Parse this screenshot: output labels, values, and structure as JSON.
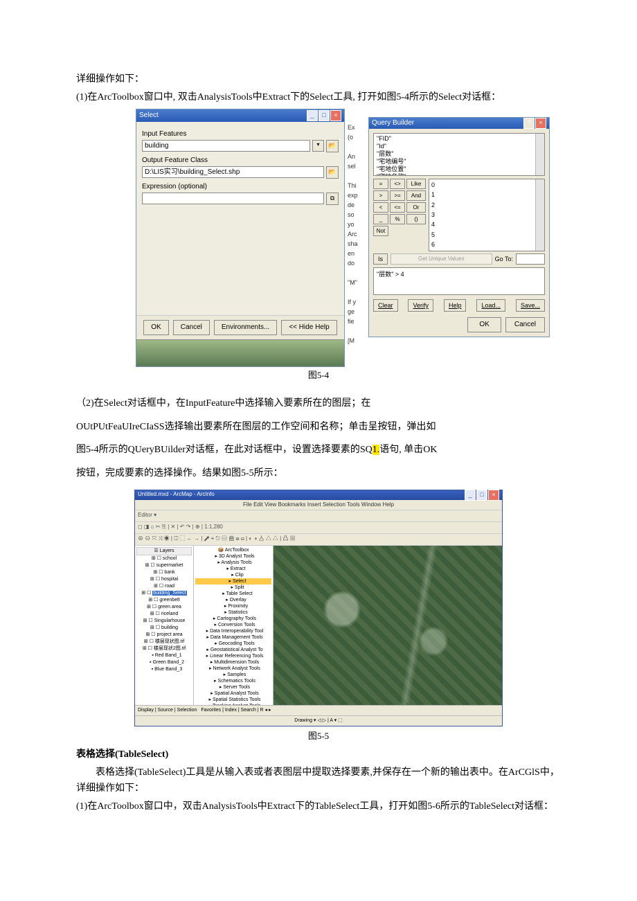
{
  "intro_line": "详细操作如下：",
  "step1": "(1)在ArcToolbox窗口中, 双击AnalysisTools中Extract下的Select工具, 打开如图5-4所示的Select对话框：",
  "fig54_caption": "图5-4",
  "select_dialog": {
    "title": "Select",
    "labels": {
      "input": "Input Features",
      "output": "Output Feature Class",
      "expr": "Expression (optional)"
    },
    "values": {
      "input": "building",
      "output": "D:\\LIS实习\\building_Select.shp",
      "expr": ""
    },
    "buttons": {
      "ok": "OK",
      "cancel": "Cancel",
      "env": "Environments...",
      "hide": "<< Hide Help"
    }
  },
  "midcol_lines": [
    "Ex",
    "(o",
    "",
    "An",
    "sel",
    "",
    "Thi",
    "exp",
    "de",
    "so",
    "yo",
    "Arc",
    "sha",
    "en",
    "do",
    "",
    "\"M\"",
    "",
    "If y",
    "ge",
    "fie",
    "",
    "[M"
  ],
  "qb": {
    "title": "Query Builder",
    "fields": [
      "\"FID\"",
      "\"Id\"",
      "\"层数\"",
      "\"宅地编号\"",
      "\"宅地位置\"",
      "\"宅地名称\""
    ],
    "ops_rows": [
      [
        "=",
        "<>",
        "Like"
      ],
      [
        ">",
        ">=",
        "And"
      ],
      [
        "<",
        "<=",
        "Or"
      ],
      [
        "_",
        "%",
        "()",
        "Not"
      ]
    ],
    "values_list": [
      "0",
      "1",
      "2",
      "3",
      "4",
      "5",
      "6"
    ],
    "is_label": "Is",
    "getunique": "Get Unique Values",
    "goto": "Go To:",
    "expression": "\"层数\" > 4",
    "buttons": {
      "clear": "Clear",
      "verify": "Verify",
      "help": "Help",
      "load": "Load...",
      "save": "Save...",
      "ok": "OK",
      "cancel": "Cancel"
    }
  },
  "para2_a": "（2)在Select对话框中，在InputFeature中选择输入要素所在的图层；在",
  "para2_b": "OUtPUtFeaUIreCIaSS选择输出要素所在图层的工作空间和名称；单击呈按钮，弹出如",
  "para2_c_a": "图5-4所示的QUeryBUilder对话框，在此对话框中，设置选择要素的SQ",
  "para2_c_hl": "1.",
  "para2_c_b": "语句, 单击OK",
  "para2_d": "按钮，完成要素的选择操作。结果如图5-5所示：",
  "arcmap": {
    "title": "Untitled.mxd - ArcMap - ArcInfo",
    "menu": "File  Edit  View  Bookmarks  Insert  Selection  Tools  Window  Help",
    "editor_bar": "Editor ▾   ",
    "toolbar_a": "◻ ◨ ⌂ ✂ ⎘ | ✕ | ↶ ↷ | ⊕ | 1:1,280",
    "toolbar_b": "⊕ ⊖ ⤧ ⤨ ◉ | ◫ ⬚ ← → | ⬈ ⌖ ⎋ ▤ 曲 ⊞ ⊟ | ◐ ◑ 亼 △ △ | 凸 ▦",
    "toc_header": "Layers",
    "toc_items": [
      "school",
      "supermarket",
      "bank",
      "hospital",
      "road",
      "building_Select",
      "greenbelt",
      "green area",
      "riceland",
      "Singularhouse",
      "building",
      "project area",
      "楼层现状图.tif",
      "楼层现状2图.tif"
    ],
    "toc_legend": [
      "Red  Band_1",
      "Green Band_2",
      "Blue  Band_3"
    ],
    "tree_root": "ArcToolbox",
    "tree": [
      "3D Analyst Tools",
      "Analysis Tools",
      " Extract",
      "  Clip",
      "  Select",
      "  Split",
      "  Table Select",
      " Overlay",
      " Proximity",
      " Statistics",
      "Cartography Tools",
      "Conversion Tools",
      "Data Interoperability Tool",
      "Data Management Tools",
      "Geocoding Tools",
      "Geostatistical Analyst To",
      "Linear Referencing Tools",
      "Multidimension Tools",
      "Network Analyst Tools",
      "Samples",
      "Schematics Tools",
      "Server Tools",
      "Spatial Analyst Tools",
      "Spatial Statistics Tools",
      "Tracking Analyst Tools"
    ],
    "tabs_left": "Display | Source | Selection",
    "tabs_mid": "Favorites | Index | Search | R ◂ ▸",
    "status": "Drawing ▾   ◁ ▷ | A ▾ ⬚"
  },
  "fig55_caption": "图5-5",
  "header2": "表格选择(TableSelect)",
  "ts_para1": "表格选择(TableSelect)工具是从输入表或者表图层中提取选择要素,并保存在一个新的输出表中。在ArCGlS中，详细操作如下：",
  "ts_step1": "(1)在ArcToolbox窗口中，双击AnalysisTools中Extract下的TableSelect工具，打开如图5-6所示的TableSelect对话框："
}
